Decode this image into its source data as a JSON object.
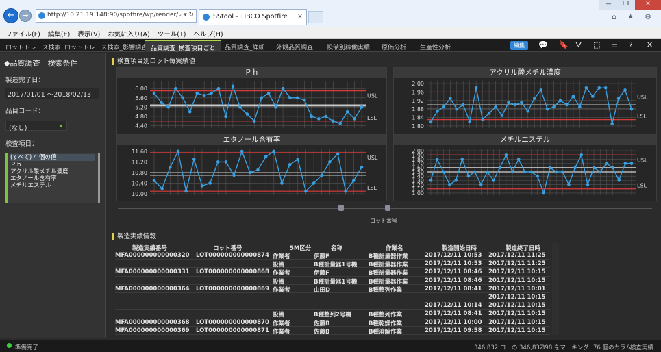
{
  "browser": {
    "address": "http://10.21.19.148:90/spotfire/wp/render/7",
    "address_controls": "⌕ ▾ ↻",
    "tab_title": "SStool - TIBCO Spotfire",
    "tab_close": "×",
    "window_min": "—",
    "window_max": "❐",
    "window_close": "✕",
    "toolbar_icons": "⌂ ★ ⚙"
  },
  "menu": [
    "ファイル(F)",
    "編集(E)",
    "表示(V)",
    "お気に入り(A)",
    "ツール(T)",
    "ヘルプ(H)"
  ],
  "tabs": [
    "ロットトレース検索",
    "ロットトレース検索_影響調査",
    "品質調査_検査項目ごと",
    "品質調査_詳細",
    "外観品質調査",
    "設備別稼働実績",
    "原価分析",
    "生産性分析"
  ],
  "active_tab": 2,
  "toolbar": {
    "edit_label": "編集",
    "icons": [
      "comment-icon",
      "bookmark-icon",
      "filter-icon",
      "select-icon",
      "menu-icon",
      "help-icon",
      "close-icon"
    ]
  },
  "filters": {
    "title": "◆品質調査　検索条件",
    "date_label": "製造完了日：",
    "date_value": "2017/01/01 ～2018/02/13",
    "code_label": "品目コード：",
    "code_value": "(なし)",
    "items_label": "検査項目：",
    "items": [
      "(すべて) 4 個の値",
      "Ｐｈ",
      "アクリル酸メチル濃度",
      "エタノール含有率",
      "メチルエステル"
    ]
  },
  "charts_panel": {
    "title": "検査項目別ロット毎実績値",
    "x_axis_label": "ロット番号",
    "usl_label": "USL",
    "lsl_label": "LSL"
  },
  "colors": {
    "line": "#3aa0e0",
    "spec": "#d83a3a",
    "mean": "#ffffff",
    "accent": "#7fc241"
  },
  "chart_data": [
    {
      "type": "line",
      "title": "Ｐｈ",
      "yticks": [
        "6.00",
        "5.60",
        "5.20",
        "4.80",
        "4.40"
      ],
      "ylim": [
        4.3,
        6.3
      ],
      "usl": 5.9,
      "lsl": 4.6,
      "mean": 5.25,
      "center": 5.3,
      "values": [
        5.8,
        5.4,
        5.2,
        6.0,
        5.6,
        5.0,
        5.8,
        5.7,
        5.8,
        6.0,
        4.8,
        6.1,
        5.2,
        4.9,
        4.6,
        5.6,
        5.8,
        5.2,
        6.0,
        5.6,
        5.6,
        5.5,
        4.8,
        4.7,
        4.8,
        4.6,
        4.5,
        5.0,
        4.7,
        5.2
      ]
    },
    {
      "type": "line",
      "title": "アクリル酸メチル濃度",
      "yticks": [
        "2.00",
        "1.96",
        "1.92",
        "1.88",
        "1.84",
        "1.80"
      ],
      "ylim": [
        1.79,
        2.01
      ],
      "usl": 1.96,
      "lsl": 1.83,
      "mean": 1.885,
      "center": 1.9,
      "values": [
        1.82,
        1.87,
        1.89,
        1.93,
        1.88,
        1.9,
        1.82,
        1.98,
        1.83,
        1.86,
        1.89,
        1.85,
        1.91,
        1.9,
        1.91,
        1.87,
        1.93,
        1.97,
        1.88,
        1.89,
        1.92,
        1.9,
        1.94,
        1.89,
        1.98,
        1.94,
        1.98,
        1.98,
        1.81,
        1.93,
        1.97,
        1.88
      ]
    },
    {
      "type": "line",
      "title": "エタノール含有率",
      "yticks": [
        "11.60",
        "11.20",
        "10.80",
        "10.40",
        "10.00"
      ],
      "ylim": [
        9.95,
        11.7
      ],
      "usl": 11.55,
      "lsl": 10.1,
      "mean": 10.7,
      "center": 10.8,
      "values": [
        10.5,
        10.2,
        11.0,
        11.6,
        10.1,
        11.3,
        10.3,
        10.4,
        11.2,
        11.2,
        10.7,
        11.6,
        10.8,
        10.9,
        11.4,
        11.6,
        10.4,
        11.1,
        11.3,
        10.1,
        10.4,
        10.7,
        11.2,
        11.5,
        10.1,
        10.5,
        11.0
      ]
    },
    {
      "type": "line",
      "title": "メチルエステル",
      "yticks": [
        "2.00",
        "1.90",
        "1.80",
        "1.70",
        "1.60",
        "1.50",
        "1.40",
        "1.30",
        "1.20",
        "1.10",
        "1.00"
      ],
      "ylim": [
        0.95,
        2.05
      ],
      "usl": 1.9,
      "lsl": 1.1,
      "mean": 1.5,
      "center": 1.6,
      "values": [
        1.3,
        1.8,
        1.5,
        1.2,
        1.3,
        1.8,
        1.4,
        1.5,
        1.2,
        1.5,
        1.3,
        1.6,
        1.9,
        1.5,
        1.8,
        1.5,
        1.5,
        1.4,
        1.0,
        1.6,
        1.5,
        1.5,
        1.2,
        1.6,
        1.9,
        1.2,
        1.6,
        1.5,
        1.7,
        1.6,
        1.3,
        1.7,
        1.7
      ]
    }
  ],
  "table": {
    "title": "製造実績情報",
    "columns": [
      "製造実績番号",
      "ロット番号",
      "5M区分",
      "名称",
      "作業名",
      "製造開始日時",
      "製造終了日時"
    ],
    "rows": [
      [
        "MFA000000000000320",
        "LOT000000000000874",
        "作業者",
        "伊藤F",
        "B種計量器作業",
        "2017/12/11 10:53",
        "2017/12/11 11:25"
      ],
      [
        "",
        "",
        "設備",
        "B種計量器1号機",
        "B種計量器作業",
        "2017/12/11 10:53",
        "2017/12/11 11:25"
      ],
      [
        "MFA000000000000331",
        "LOT000000000000868",
        "作業者",
        "伊藤F",
        "B種計量器作業",
        "2017/12/11 08:46",
        "2017/12/11 10:15"
      ],
      [
        "",
        "",
        "設備",
        "B種計量器1号機",
        "B種計量器作業",
        "2017/12/11 08:46",
        "2017/12/11 10:15"
      ],
      [
        "MFA000000000000364",
        "LOT000000000000869",
        "作業者",
        "山田D",
        "B種整列作業",
        "2017/12/11 08:41",
        "2017/12/11 10:01"
      ],
      [
        "",
        "",
        "",
        "",
        "",
        "",
        "2017/12/11 10:15"
      ],
      [
        "",
        "",
        "",
        "",
        "",
        "2017/12/11 10:14",
        "2017/12/11 10:15"
      ],
      [
        "",
        "",
        "設備",
        "B種整列2号機",
        "B種整列作業",
        "2017/12/11 08:41",
        "2017/12/11 10:15"
      ],
      [
        "MFA000000000000368",
        "LOT000000000000870",
        "作業者",
        "佐藤B",
        "B種乾燥作業",
        "2017/12/11 10:00",
        "2017/12/11 10:15"
      ],
      [
        "MFA000000000000369",
        "LOT000000000000871",
        "作業者",
        "佐藤B",
        "B種溶解作業",
        "2017/12/11 09:58",
        "2017/12/11 10:15"
      ]
    ]
  },
  "status": {
    "ready": "準備完了",
    "rows": "346,832 ローの 346,832",
    "marking": "398 をマーキング",
    "columns": "76 個のカラム",
    "table_name": "検査実績"
  }
}
